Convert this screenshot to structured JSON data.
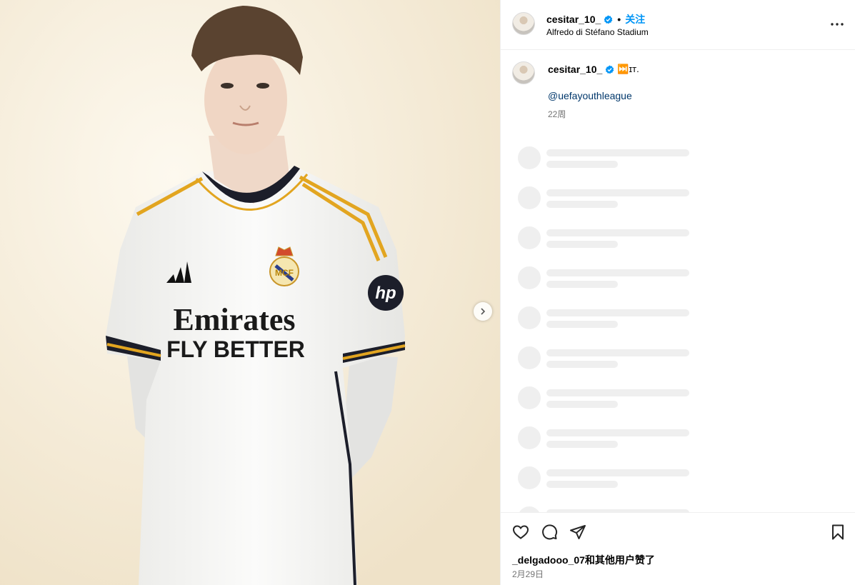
{
  "post": {
    "username": "cesitar_10_",
    "follow_label": "关注",
    "dot": "•",
    "location": "Alfredo di Stéfano Stadium",
    "caption_text": "⏭️ɪᴛ.",
    "caption_mention": "@uefayouthleague",
    "caption_time": "22周",
    "likes_text": "_delgadooo_07和其他用户赞了",
    "date": "2月29日"
  },
  "photo": {
    "sponsor_line1": "Emirates",
    "sponsor_line2": "FLY BETTER",
    "kit_colors": {
      "shirt": "#f6f6f4",
      "trim": "#e2a520",
      "collar": "#1c1e2a",
      "hair": "#5a4330"
    }
  },
  "icons": {
    "verified": "verified-badge-icon",
    "more": "more-options-icon",
    "next": "chevron-right-icon",
    "like": "heart-icon",
    "comment": "comment-icon",
    "share": "send-icon",
    "save": "bookmark-icon"
  },
  "colors": {
    "accent": "#0095f6",
    "mention": "#00376b",
    "muted": "#737373",
    "skeleton": "#efefef"
  },
  "skeleton_rows": 10
}
